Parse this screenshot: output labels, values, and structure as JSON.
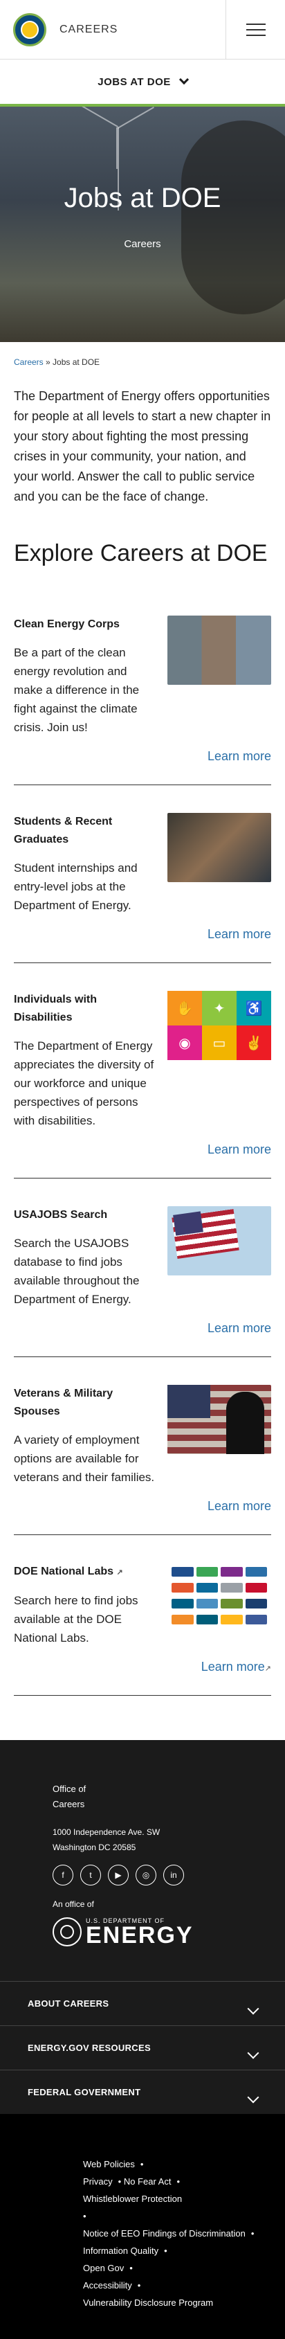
{
  "header": {
    "site_name": "CAREERS",
    "section_nav_label": "JOBS AT DOE"
  },
  "hero": {
    "title": "Jobs at DOE",
    "subtitle": "Careers"
  },
  "breadcrumb": {
    "parent": "Careers",
    "separator": " » ",
    "current": "Jobs at DOE"
  },
  "intro": "The Department of Energy offers opportunities for people at all levels to start a new chapter in your story about fighting the most pressing crises in your community, your nation, and your world. Answer the call to public service and you can be the face of change.",
  "explore_title": "Explore Careers at DOE",
  "cards": [
    {
      "title": "Clean Energy Corps",
      "body": "Be a part of the clean energy revolution and make a difference in the fight against the climate crisis. Join us!",
      "link": "Learn more"
    },
    {
      "title": "Students & Recent Graduates",
      "body": "Student internships and entry-level jobs at the Department of Energy.",
      "link": "Learn more"
    },
    {
      "title": "Individuals with Disabilities",
      "body": "The Department of Energy appreciates the diversity of our workforce and unique perspectives of persons with disabilities.",
      "link": "Learn more"
    },
    {
      "title": "USAJOBS Search",
      "body": "Search the USAJOBS database to find jobs available throughout the Department of Energy.",
      "link": "Learn more"
    },
    {
      "title": "Veterans & Military Spouses",
      "body": "A variety of employment options are available for veterans and their families.",
      "link": "Learn more"
    },
    {
      "title": "DOE National Labs",
      "body": "Search here to find jobs available at the DOE National Labs.",
      "link": "Learn more"
    }
  ],
  "footer": {
    "office_line1": "Office of",
    "office_line2": "Careers",
    "address1": "1000 Independence Ave. SW",
    "address2": "Washington DC 20585",
    "office_of": "An office of",
    "doe_small": "U.S. DEPARTMENT OF",
    "doe_big": "ENERGY",
    "accordion": [
      "ABOUT CAREERS",
      "ENERGY.GOV RESOURCES",
      "FEDERAL GOVERNMENT"
    ],
    "legal": [
      "Web Policies",
      "Privacy",
      "No Fear Act",
      "Whistleblower Protection",
      "Notice of EEO Findings of Discrimination",
      "Information Quality",
      "Open Gov",
      "Accessibility",
      "Vulnerability Disclosure Program"
    ]
  },
  "colors": {
    "accent_green": "#7ab648",
    "link_blue": "#2a6fa8",
    "footer_bg": "#1b1b1b"
  }
}
